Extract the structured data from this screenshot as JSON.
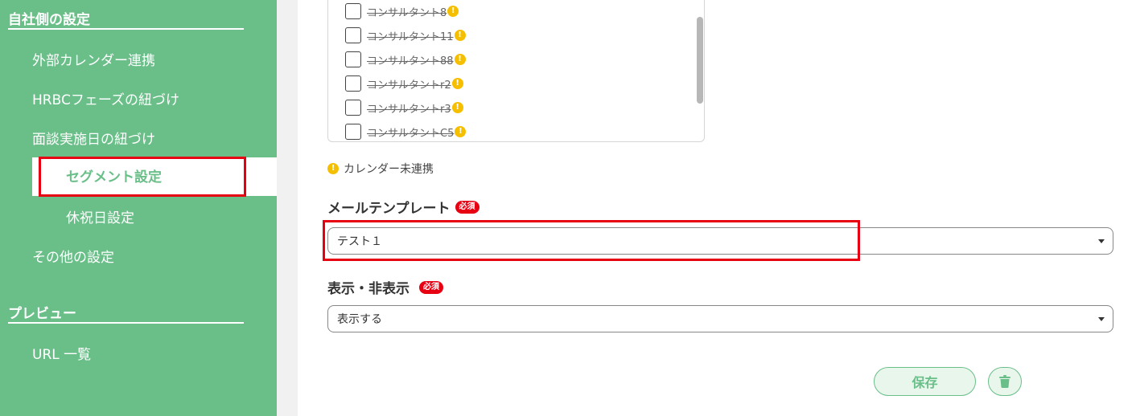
{
  "sidebar": {
    "company_section_title": "自社側の設定",
    "items": [
      {
        "label": "外部カレンダー連携"
      },
      {
        "label": "HRBCフェーズの紐づけ"
      },
      {
        "label": "面談実施日の紐づけ"
      },
      {
        "label": "セグメント設定"
      },
      {
        "label": "休祝日設定"
      },
      {
        "label": "その他の設定"
      }
    ],
    "active_item": "セグメント設定",
    "preview_section_title": "プレビュー",
    "preview_items": [
      {
        "label": "URL 一覧"
      }
    ]
  },
  "consultants": {
    "rows": [
      {
        "label": "コンサルタント8"
      },
      {
        "label": "コンサルタント11"
      },
      {
        "label": "コンサルタント88"
      },
      {
        "label": "コンサルタントr2"
      },
      {
        "label": "コンサルタントr3"
      },
      {
        "label": "コンサルタントC5"
      }
    ],
    "warning_glyph": "!"
  },
  "legend": {
    "text": "カレンダー未連携"
  },
  "mail_template": {
    "label": "メールテンプレート",
    "required": "必須",
    "value": "テスト１"
  },
  "visibility": {
    "label": "表示・非表示",
    "required": "必須",
    "value": "表示する"
  },
  "actions": {
    "save_label": "保存"
  },
  "colors": {
    "brand_green": "#6abf89",
    "required_red": "#e60012",
    "warning_yellow": "#f5bf00"
  }
}
